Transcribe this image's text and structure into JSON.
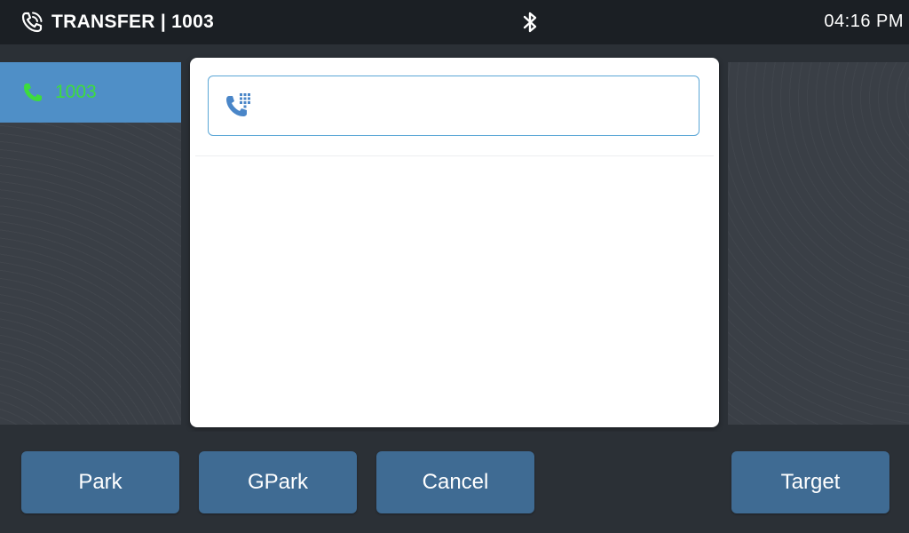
{
  "status_bar": {
    "title": "TRANSFER | 1003",
    "time": "04:16 PM",
    "call_icon": "phone-ringing-icon",
    "bluetooth_icon": "bluetooth-icon"
  },
  "line_list": {
    "items": [
      {
        "label": "1003",
        "icon": "phone-icon",
        "selected": true
      }
    ]
  },
  "dialog": {
    "input": {
      "value": "",
      "placeholder": "",
      "icon": "dialpad-phone-icon"
    }
  },
  "softkeys": {
    "park": "Park",
    "gpark": "GPark",
    "cancel": "Cancel",
    "target": "Target"
  },
  "colors": {
    "accent": "#4f8fc7",
    "softkey": "#3f6b93",
    "active_line": "#3ddc3d",
    "field_border": "#5aa6d6"
  }
}
